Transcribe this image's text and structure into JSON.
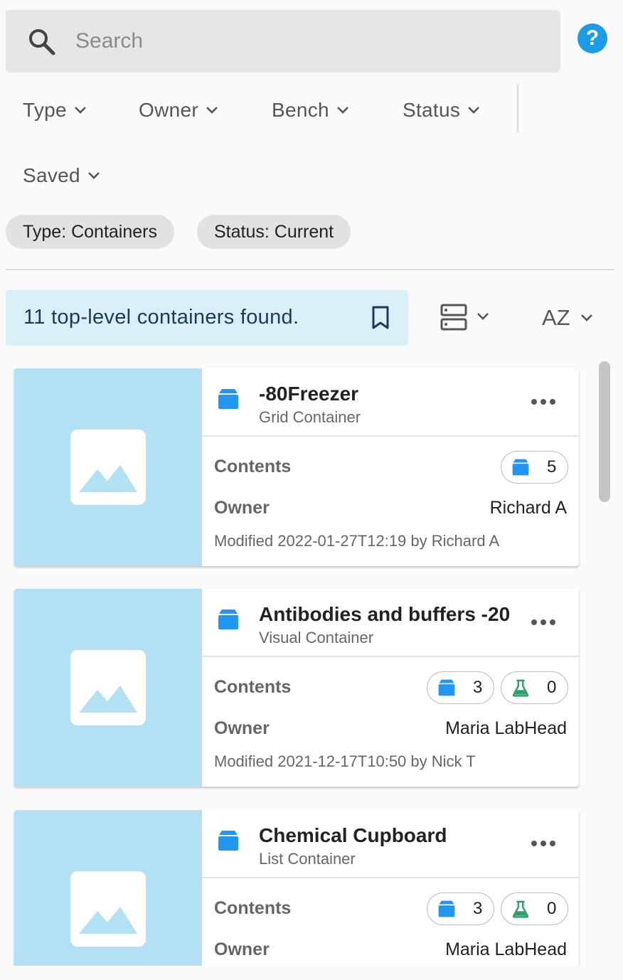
{
  "search": {
    "placeholder": "Search"
  },
  "help": {
    "label": "?"
  },
  "filters": [
    {
      "label": "Type"
    },
    {
      "label": "Owner"
    },
    {
      "label": "Bench"
    },
    {
      "label": "Status"
    },
    {
      "label": "Saved"
    }
  ],
  "chips": [
    {
      "label": "Type: Containers"
    },
    {
      "label": "Status: Current"
    }
  ],
  "results": {
    "summary": "11 top-level containers found."
  },
  "sort": {
    "label": "AZ"
  },
  "labels": {
    "contents": "Contents",
    "owner": "Owner"
  },
  "colors": {
    "accent": "#1e9be6",
    "thumb_bg": "#b3e0f2",
    "container_icon": "#2196f3",
    "sample_icon": "#2e9e6b",
    "banner_bg": "#d9f0f9"
  },
  "cards": [
    {
      "title": "-80Freezer",
      "subtitle": "Grid Container",
      "container_count": "5",
      "owner": "Richard A",
      "modified": "Modified 2022-01-27T12:19 by Richard A"
    },
    {
      "title": "Antibodies and buffers -20",
      "subtitle": "Visual Container",
      "container_count": "3",
      "sample_count": "0",
      "owner": "Maria LabHead",
      "modified": "Modified 2021-12-17T10:50 by Nick T"
    },
    {
      "title": "Chemical Cupboard",
      "subtitle": "List Container",
      "container_count": "3",
      "sample_count": "0",
      "owner": "Maria LabHead",
      "modified": ""
    }
  ]
}
